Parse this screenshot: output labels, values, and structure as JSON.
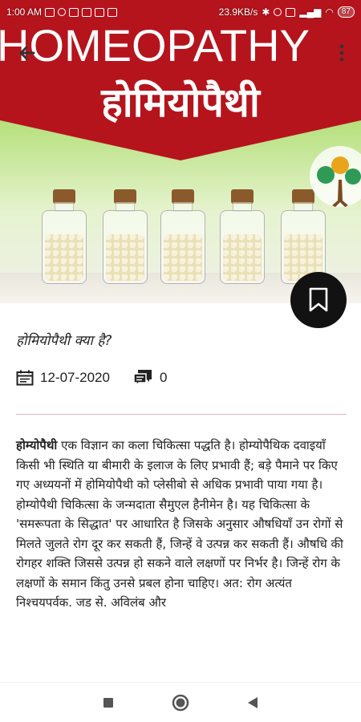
{
  "status_bar": {
    "time": "1:00 AM",
    "network_speed": "23.9KB/s",
    "battery": "87"
  },
  "hero": {
    "banner_title_en": "HOMEOPATHY",
    "banner_title_hi": "होमियोपैथी",
    "banner_color": "#b5141d"
  },
  "article": {
    "subtitle": "होमियोपैथी क्या है?",
    "date": "12-07-2020",
    "comment_count": "0",
    "lead_bold": "होम्योपैथी",
    "body": " एक विज्ञान का कला चिकित्सा पद्धति है।  होम्योपैथिक दवाइयाँ किसी भी स्थिति या बीमारी के इलाज के लिए प्रभावी हैं; बड़े पैमाने पर किए गए अध्ययनों में होमियोपैथी को प्लेसीबो से अधिक प्रभावी पाया गया है। होम्योपैथी चिकित्सा के जन्मदाता सैमुएल हैनीमेन है। यह चिकित्सा के 'समरूपता के सिद्धात' पर आधारित है जिसके अनुसार औषधियाँ उन रोगों से मिलते जुलते रोग दूर कर सकती हैं, जिन्हें वे उत्पन्न कर सकती हैं। औषधि की रोगहर शक्ति जिससे उत्पन्न हो सकने वाले लक्षणों पर निर्भर है। जिन्हें रोग के लक्षणों के समान किंतु उनसे प्रबल होना चाहिए। अत: रोग अत्यंत निश्चयपर्वक. जड से. अविलंब और"
  },
  "icons": {
    "back": "arrow-back-icon",
    "menu": "more-vert-icon",
    "bookmark": "bookmark-icon",
    "calendar": "calendar-icon",
    "comments": "comments-icon",
    "nav_recents": "square-recents-icon",
    "nav_home": "circle-home-icon",
    "nav_back": "triangle-back-icon"
  }
}
